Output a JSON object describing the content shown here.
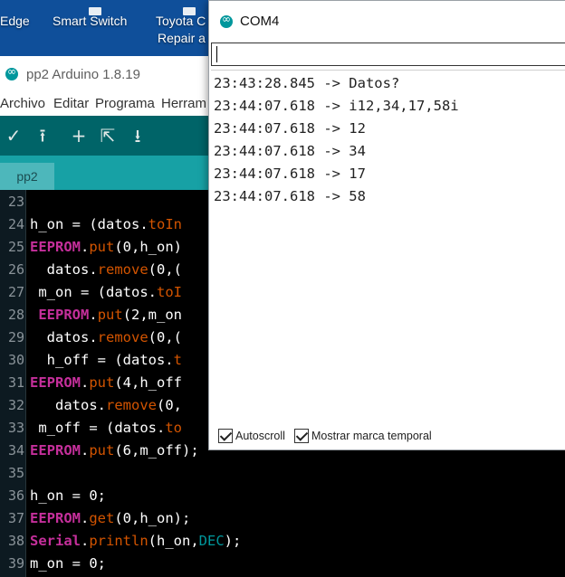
{
  "desktop": {
    "icons": [
      {
        "label": "Edge"
      },
      {
        "label": "Smart Switch"
      },
      {
        "label_line1": "Toyota C",
        "label_line2": "Repair a"
      }
    ]
  },
  "ide": {
    "title": "pp2 Arduino 1.8.19",
    "menu": [
      "Archivo",
      "Editar",
      "Programa",
      "Herram"
    ],
    "toolbar": {
      "verify": "✓",
      "upload": "⭱",
      "new": "+",
      "open": "⇱",
      "save": "⭳"
    },
    "tab": "pp2",
    "lines": [
      {
        "n": "23",
        "parts": []
      },
      {
        "n": "24",
        "parts": [
          {
            "t": "h_on = (datos.",
            "c": ""
          },
          {
            "t": "toIn",
            "c": "fn"
          }
        ]
      },
      {
        "n": "25",
        "parts": [
          {
            "t": "EEPROM",
            "c": "kw"
          },
          {
            "t": ".",
            "c": ""
          },
          {
            "t": "put",
            "c": "fn"
          },
          {
            "t": "(0,h_on)",
            "c": ""
          }
        ]
      },
      {
        "n": "26",
        "parts": [
          {
            "t": "  datos.",
            "c": ""
          },
          {
            "t": "remove",
            "c": "fn"
          },
          {
            "t": "(0,(",
            "c": ""
          }
        ]
      },
      {
        "n": "27",
        "parts": [
          {
            "t": " m_on = (datos.",
            "c": ""
          },
          {
            "t": "toI",
            "c": "fn"
          }
        ]
      },
      {
        "n": "28",
        "parts": [
          {
            "t": " ",
            "c": ""
          },
          {
            "t": "EEPROM",
            "c": "kw"
          },
          {
            "t": ".",
            "c": ""
          },
          {
            "t": "put",
            "c": "fn"
          },
          {
            "t": "(2,m_on",
            "c": ""
          }
        ]
      },
      {
        "n": "29",
        "parts": [
          {
            "t": "  datos.",
            "c": ""
          },
          {
            "t": "remove",
            "c": "fn"
          },
          {
            "t": "(0,(",
            "c": ""
          }
        ]
      },
      {
        "n": "30",
        "parts": [
          {
            "t": "  h_off = (datos.",
            "c": ""
          },
          {
            "t": "t",
            "c": "fn"
          }
        ]
      },
      {
        "n": "31",
        "parts": [
          {
            "t": "EEPROM",
            "c": "kw"
          },
          {
            "t": ".",
            "c": ""
          },
          {
            "t": "put",
            "c": "fn"
          },
          {
            "t": "(4,h_off",
            "c": ""
          }
        ]
      },
      {
        "n": "32",
        "parts": [
          {
            "t": "   datos.",
            "c": ""
          },
          {
            "t": "remove",
            "c": "fn"
          },
          {
            "t": "(0,",
            "c": ""
          }
        ]
      },
      {
        "n": "33",
        "parts": [
          {
            "t": " m_off = (datos.",
            "c": ""
          },
          {
            "t": "to",
            "c": "fn"
          }
        ]
      },
      {
        "n": "34",
        "parts": [
          {
            "t": "EEPROM",
            "c": "kw"
          },
          {
            "t": ".",
            "c": ""
          },
          {
            "t": "put",
            "c": "fn"
          },
          {
            "t": "(6,m_off);",
            "c": ""
          }
        ]
      },
      {
        "n": "35",
        "parts": []
      },
      {
        "n": "36",
        "parts": [
          {
            "t": "h_on = 0;",
            "c": ""
          }
        ]
      },
      {
        "n": "37",
        "parts": [
          {
            "t": "EEPROM",
            "c": "kw"
          },
          {
            "t": ".",
            "c": ""
          },
          {
            "t": "get",
            "c": "fn"
          },
          {
            "t": "(0,h_on);",
            "c": ""
          }
        ]
      },
      {
        "n": "38",
        "parts": [
          {
            "t": "Serial",
            "c": "kw"
          },
          {
            "t": ".",
            "c": ""
          },
          {
            "t": "println",
            "c": "fn"
          },
          {
            "t": "(h_on,",
            "c": ""
          },
          {
            "t": "DEC",
            "c": "cn"
          },
          {
            "t": ");",
            "c": ""
          }
        ]
      },
      {
        "n": "39",
        "parts": [
          {
            "t": "m_on = 0;",
            "c": ""
          }
        ]
      }
    ]
  },
  "serial": {
    "title": "COM4",
    "input_value": "",
    "output": [
      "23:43:28.845 -> Datos?",
      "23:44:07.618 -> i12,34,17,58i",
      "23:44:07.618 -> 12",
      "23:44:07.618 -> 34",
      "23:44:07.618 -> 17",
      "23:44:07.618 -> 58"
    ],
    "autoscroll_label": "Autoscroll",
    "timestamp_label": "Mostrar marca temporal",
    "autoscroll_checked": true,
    "timestamp_checked": true
  }
}
